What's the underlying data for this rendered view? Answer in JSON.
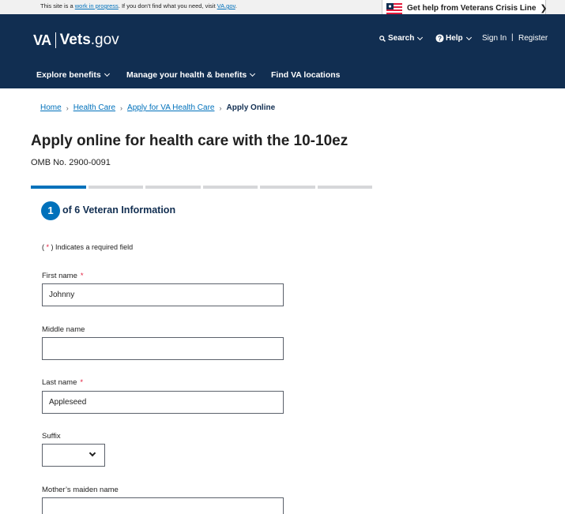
{
  "notice": {
    "prefix": "This site is a ",
    "work_link": "work in progress",
    "middle": ". If you don't find what you need, visit ",
    "va_link": "VA.gov",
    "suffix": "."
  },
  "crisis": {
    "label": "Get help from Veterans Crisis Line"
  },
  "header": {
    "logo_va": "VA",
    "logo_vets": "Vets",
    "logo_gov": ".gov",
    "search": "Search",
    "help": "Help",
    "signin": "Sign In",
    "separator": "|",
    "register": "Register"
  },
  "nav": {
    "explore": "Explore benefits",
    "manage": "Manage your health & benefits",
    "find": "Find VA locations"
  },
  "breadcrumb": {
    "home": "Home",
    "health_care": "Health Care",
    "apply_va": "Apply for VA Health Care",
    "current": "Apply Online"
  },
  "page": {
    "title": "Apply online for health care with the 10-10ez",
    "omb": "OMB No. 2900-0091"
  },
  "progress": {
    "total_steps": 6,
    "current_step": 1
  },
  "step": {
    "number": "1",
    "heading": "of 6 Veteran Information"
  },
  "required_note": {
    "open": "( ",
    "star": "*",
    "close": " ) Indicates a required field"
  },
  "form": {
    "first_name": {
      "label": "First name",
      "required": "*",
      "value": "Johnny"
    },
    "middle_name": {
      "label": "Middle name",
      "value": ""
    },
    "last_name": {
      "label": "Last name",
      "required": "*",
      "value": "Appleseed"
    },
    "suffix": {
      "label": "Suffix",
      "value": ""
    },
    "maiden_name": {
      "label": "Mother’s maiden name",
      "value": ""
    }
  },
  "colors": {
    "header_bg": "#112e51",
    "link": "#0071bb",
    "required": "#e31c3d",
    "progress_active": "#0071bb",
    "progress_inactive": "#d6d7d9"
  }
}
